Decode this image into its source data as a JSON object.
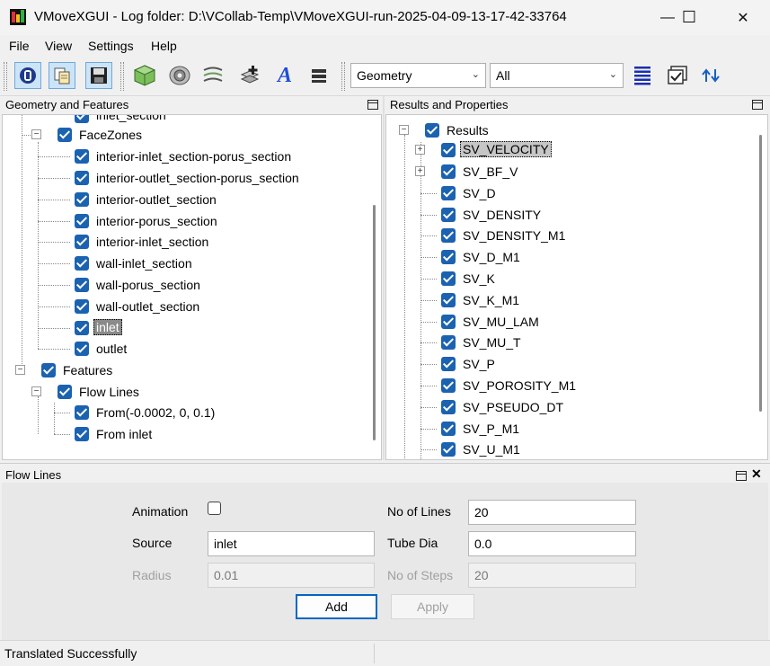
{
  "window": {
    "title": "VMoveXGUI - Log folder: D:\\VCollab-Temp\\VMoveXGUI-run-2025-04-09-13-17-42-33764",
    "minimize_glyph": "—",
    "maximize_glyph": "☐",
    "close_glyph": "✕"
  },
  "menu": {
    "file": "File",
    "view": "View",
    "settings": "Settings",
    "help": "Help"
  },
  "toolbar": {
    "icons": [
      "vcollab-logo-icon",
      "copy-icon",
      "save-icon",
      "geometry-cube-icon",
      "surface-icon",
      "layers-icon",
      "add-part-icon",
      "text-icon",
      "stack-icon",
      "list-icon",
      "window-checkbox-icon",
      "swap-icon"
    ],
    "geometry_combo": "Geometry",
    "filter_combo": "All",
    "text_icon_glyph": "A"
  },
  "geometry_panel": {
    "title": "Geometry and Features",
    "top_partial": "inlet_section",
    "facezones_label": "FaceZones",
    "facezones": [
      "interior-inlet_section-porus_section",
      "interior-outlet_section-porus_section",
      "interior-outlet_section",
      "interior-porus_section",
      "interior-inlet_section",
      "wall-inlet_section",
      "wall-porus_section",
      "wall-outlet_section",
      "inlet",
      "outlet"
    ],
    "features_label": "Features",
    "flowlines_label": "Flow Lines",
    "flowlines": [
      "From(-0.0002, 0, 0.1)",
      "From inlet"
    ],
    "expander_collapse": "−"
  },
  "results_panel": {
    "title": "Results and Properties",
    "root_label": "Results",
    "items": [
      "SV_VELOCITY",
      "SV_BF_V",
      "SV_D",
      "SV_DENSITY",
      "SV_DENSITY_M1",
      "SV_D_M1",
      "SV_K",
      "SV_K_M1",
      "SV_MU_LAM",
      "SV_MU_T",
      "SV_P",
      "SV_POROSITY_M1",
      "SV_PSEUDO_DT",
      "SV_P_M1",
      "SV_U_M1"
    ],
    "expander_expand": "+"
  },
  "flow_panel": {
    "title": "Flow Lines",
    "close_glyph": "✕",
    "animation_label": "Animation",
    "source_label": "Source",
    "source_value": "inlet",
    "radius_label": "Radius",
    "radius_value": "0.01",
    "no_of_lines_label": "No of Lines",
    "no_of_lines_value": "20",
    "tube_dia_label": "Tube Dia",
    "tube_dia_value": "0.0",
    "no_of_steps_label": "No of Steps",
    "no_of_steps_value": "20",
    "add_label": "Add",
    "apply_label": "Apply"
  },
  "status": {
    "message": "Translated Successfully"
  }
}
